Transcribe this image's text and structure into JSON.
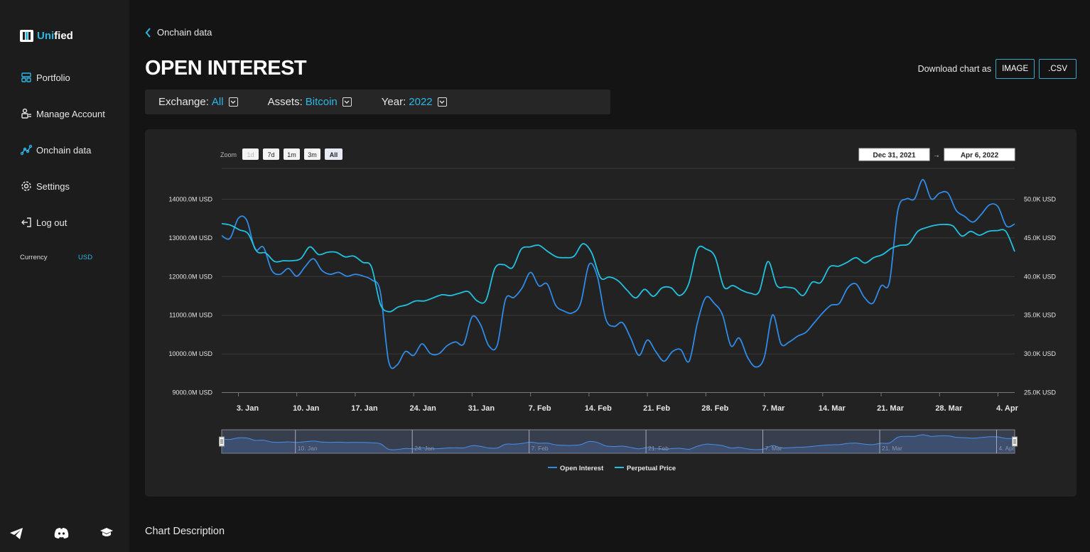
{
  "app": {
    "name_part1": "Uni",
    "name_part2": "fied"
  },
  "sidebar": {
    "items": [
      {
        "label": "Portfolio",
        "icon": "portfolio-icon"
      },
      {
        "label": "Manage Account",
        "icon": "account-icon"
      },
      {
        "label": "Onchain data",
        "icon": "onchain-icon"
      },
      {
        "label": "Settings",
        "icon": "gear-icon"
      },
      {
        "label": "Log out",
        "icon": "logout-icon"
      }
    ],
    "currency_label": "Currency",
    "currency_value": "USD",
    "social": [
      "telegram-icon",
      "discord-icon",
      "docs-icon"
    ]
  },
  "header": {
    "back_label": "Onchain data",
    "title": "OPEN INTEREST",
    "download_label": "Download chart as",
    "image_btn": "IMAGE",
    "csv_btn": ".CSV"
  },
  "filters": {
    "exchange_label": "Exchange:",
    "exchange_value": "All",
    "assets_label": "Assets:",
    "assets_value": "Bitcoin",
    "year_label": "Year:",
    "year_value": "2022"
  },
  "chart_controls": {
    "zoom_label": "Zoom",
    "zoom_buttons": [
      "1d",
      "7d",
      "1m",
      "3m",
      "All"
    ],
    "zoom_active": "All",
    "zoom_disabled": "1d",
    "date_from": "Dec 31, 2021",
    "date_to": "Apr 6, 2022",
    "arrow": "→"
  },
  "colors": {
    "accent": "#2bb7e6",
    "open_interest": "#2f8be6",
    "perpetual_price": "#21c2e0"
  },
  "chart_data": {
    "type": "line",
    "x_start": "2022-01-01",
    "x_end": "2022-04-06",
    "x_tick_labels": [
      "3. Jan",
      "10. Jan",
      "17. Jan",
      "24. Jan",
      "31. Jan",
      "7. Feb",
      "14. Feb",
      "21. Feb",
      "28. Feb",
      "7. Mar",
      "14. Mar",
      "21. Mar",
      "28. Mar",
      "4. Apr"
    ],
    "navigator_labels": [
      "10. Jan",
      "24. Jan",
      "7. Feb",
      "21. Feb",
      "7. Mar",
      "21. Mar",
      "4. Apr"
    ],
    "y_left": {
      "ticks": [
        "9000.0M USD",
        "10000.0M USD",
        "11000.0M USD",
        "12000.0M USD",
        "13000.0M USD",
        "14000.0M USD"
      ],
      "ylim": [
        9000,
        14000
      ],
      "unit": "M USD"
    },
    "y_right": {
      "ticks": [
        "25.0K USD",
        "30.0K USD",
        "35.0K USD",
        "40.0K USD",
        "45.0K USD",
        "50.0K USD"
      ],
      "ylim": [
        25,
        50
      ],
      "unit": "K USD"
    },
    "legend": [
      "Open Interest",
      "Perpetual Price"
    ],
    "legend_position": "bottom-center",
    "grid": true,
    "series": [
      {
        "name": "Open Interest",
        "axis": "left",
        "color": "#2f8be6",
        "values": [
          13050,
          12980,
          13500,
          13450,
          12700,
          12750,
          12150,
          12050,
          12200,
          12000,
          12250,
          12450,
          12150,
          12050,
          12100,
          12000,
          12050,
          12000,
          11900,
          11600,
          9800,
          9700,
          10050,
          9950,
          10250,
          10000,
          9990,
          10200,
          10300,
          10250,
          10950,
          10750,
          10200,
          10210,
          11400,
          11450,
          11700,
          12100,
          11750,
          11800,
          11250,
          11100,
          11050,
          11300,
          12300,
          12000,
          10900,
          10700,
          10800,
          10400,
          9950,
          10350,
          10050,
          9800,
          10050,
          10100,
          9800,
          10800,
          11450,
          11300,
          11000,
          10200,
          10400,
          9900,
          9650,
          9900,
          11000,
          10250,
          10300,
          10450,
          10550,
          10800,
          11050,
          11250,
          11300,
          11700,
          11800,
          11450,
          11300,
          11750,
          11850,
          13700,
          14000,
          14000,
          14500,
          14000,
          14150,
          14150,
          13700,
          13550,
          13400,
          13600,
          13850,
          13800,
          13300,
          13350
        ]
      },
      {
        "name": "Perpetual Price",
        "axis": "right",
        "color": "#21c2e0",
        "values": [
          46.8,
          46.6,
          46.0,
          45.5,
          43.2,
          43.0,
          41.9,
          42.0,
          42.0,
          42.3,
          43.8,
          42.8,
          43.1,
          43.1,
          42.5,
          42.6,
          41.8,
          41.2,
          36.4,
          35.4,
          36.0,
          36.3,
          36.8,
          36.8,
          37.2,
          37.6,
          37.5,
          37.8,
          38.0,
          36.8,
          36.9,
          41.0,
          41.5,
          41.1,
          43.5,
          43.8,
          44.0,
          43.2,
          42.5,
          42.4,
          42.6,
          44.2,
          43.0,
          39.8,
          39.9,
          39.4,
          38.2,
          37.2,
          38.3,
          37.4,
          38.5,
          38.5,
          37.5,
          39.0,
          43.5,
          43.5,
          42.5,
          38.6,
          38.8,
          38.2,
          37.8,
          38.0,
          41.9,
          38.8,
          38.6,
          38.4,
          37.5,
          39.2,
          39.2,
          41.2,
          41.3,
          41.8,
          42.4,
          41.7,
          42.4,
          42.8,
          43.6,
          44.0,
          44.2,
          45.8,
          46.3,
          46.6,
          46.7,
          46.5,
          45.2,
          45.8,
          45.3,
          45.8,
          45.9,
          45.8,
          43.2
        ]
      }
    ]
  },
  "footer": {
    "description_title": "Chart Description"
  }
}
